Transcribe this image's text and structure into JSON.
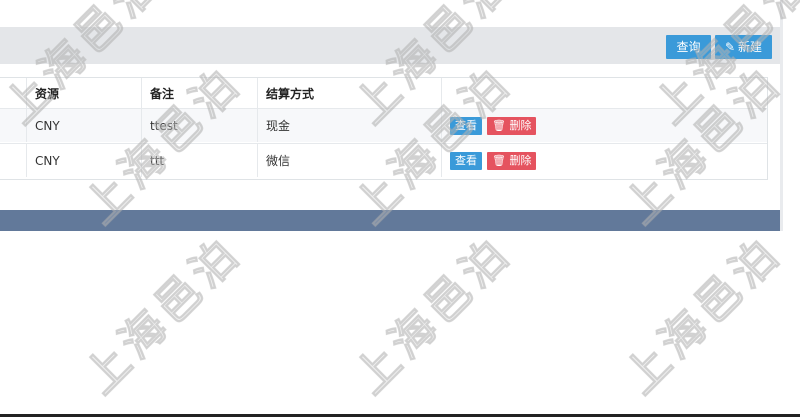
{
  "toolbar": {
    "query_label": "查询",
    "new_label": "新建",
    "new_icon": "pencil-icon"
  },
  "table": {
    "headers": [
      "资源",
      "备注",
      "结算方式"
    ],
    "rows": [
      {
        "currency": "CNY",
        "note": "ttest",
        "settlement": "现金"
      },
      {
        "currency": "CNY",
        "note": "ttt",
        "settlement": "微信"
      }
    ],
    "actions": {
      "view_label": "查看",
      "delete_label": "删除",
      "delete_icon": "trash-icon"
    }
  },
  "watermark": "上海邑泊",
  "colors": {
    "primary": "#3a9ad9",
    "danger": "#e5535f",
    "footer": "#62799a",
    "toolbar_bg": "#e4e6e9"
  }
}
